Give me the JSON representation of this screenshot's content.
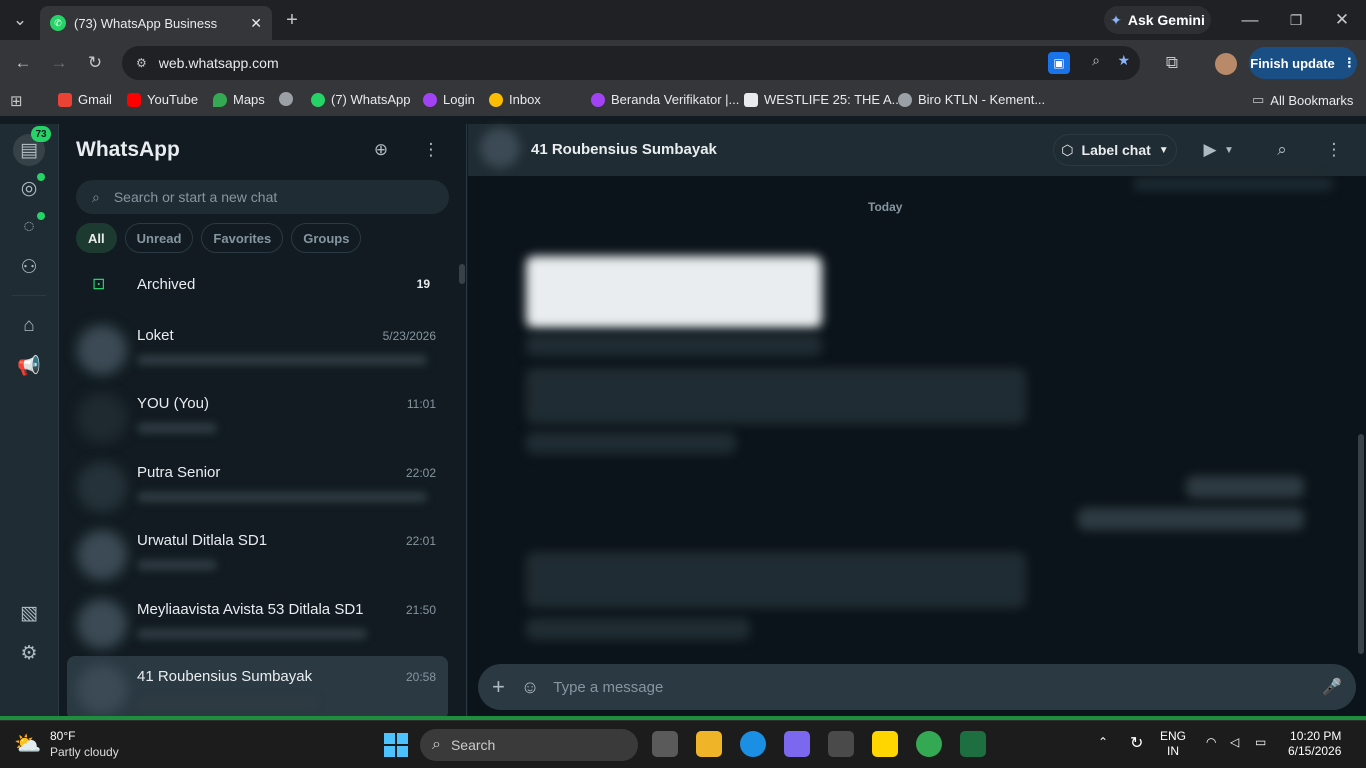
{
  "browser": {
    "tab_title": "(73) WhatsApp Business",
    "url": "web.whatsapp.com",
    "ask_gemini": "Ask Gemini",
    "finish_update": "Finish update",
    "bookmarks": [
      "Gmail",
      "YouTube",
      "Maps",
      "(7) WhatsApp",
      "Login",
      "Inbox",
      "Beranda Verifikator |...",
      "WESTLIFE 25: THE A...",
      "Biro KTLN - Kement..."
    ],
    "all_bookmarks": "All Bookmarks"
  },
  "whatsapp": {
    "rail_badge": "73",
    "title": "WhatsApp",
    "search_placeholder": "Search or start a new chat",
    "filters": [
      "All",
      "Unread",
      "Favorites",
      "Groups"
    ],
    "archived_label": "Archived",
    "archived_count": "19",
    "chats": [
      {
        "name": "Loket",
        "time": "5/23/2026"
      },
      {
        "name": "YOU (You)",
        "time": "11:01"
      },
      {
        "name": "Putra Senior",
        "time": "22:02"
      },
      {
        "name": "Urwatul Ditlala SD1",
        "time": "22:01"
      },
      {
        "name": "Meyliaavista Avista 53 Ditlala SD1",
        "time": "21:50"
      },
      {
        "name": "41 Roubensius Sumbayak",
        "time": "20:58"
      }
    ],
    "active_chat": "41 Roubensius Sumbayak",
    "label_chat": "Label chat",
    "date_divider": "Today",
    "composer_placeholder": "Type a message"
  },
  "taskbar": {
    "weather_temp": "80°F",
    "weather_desc": "Partly cloudy",
    "search_label": "Search",
    "lang_top": "ENG",
    "lang_bottom": "IN",
    "time": "10:20 PM",
    "date": "6/15/2026"
  },
  "colors": {
    "accent_green": "#25d366",
    "panel": "#111b21",
    "header": "#202c33",
    "chrome_blue": "#1a4f86"
  }
}
